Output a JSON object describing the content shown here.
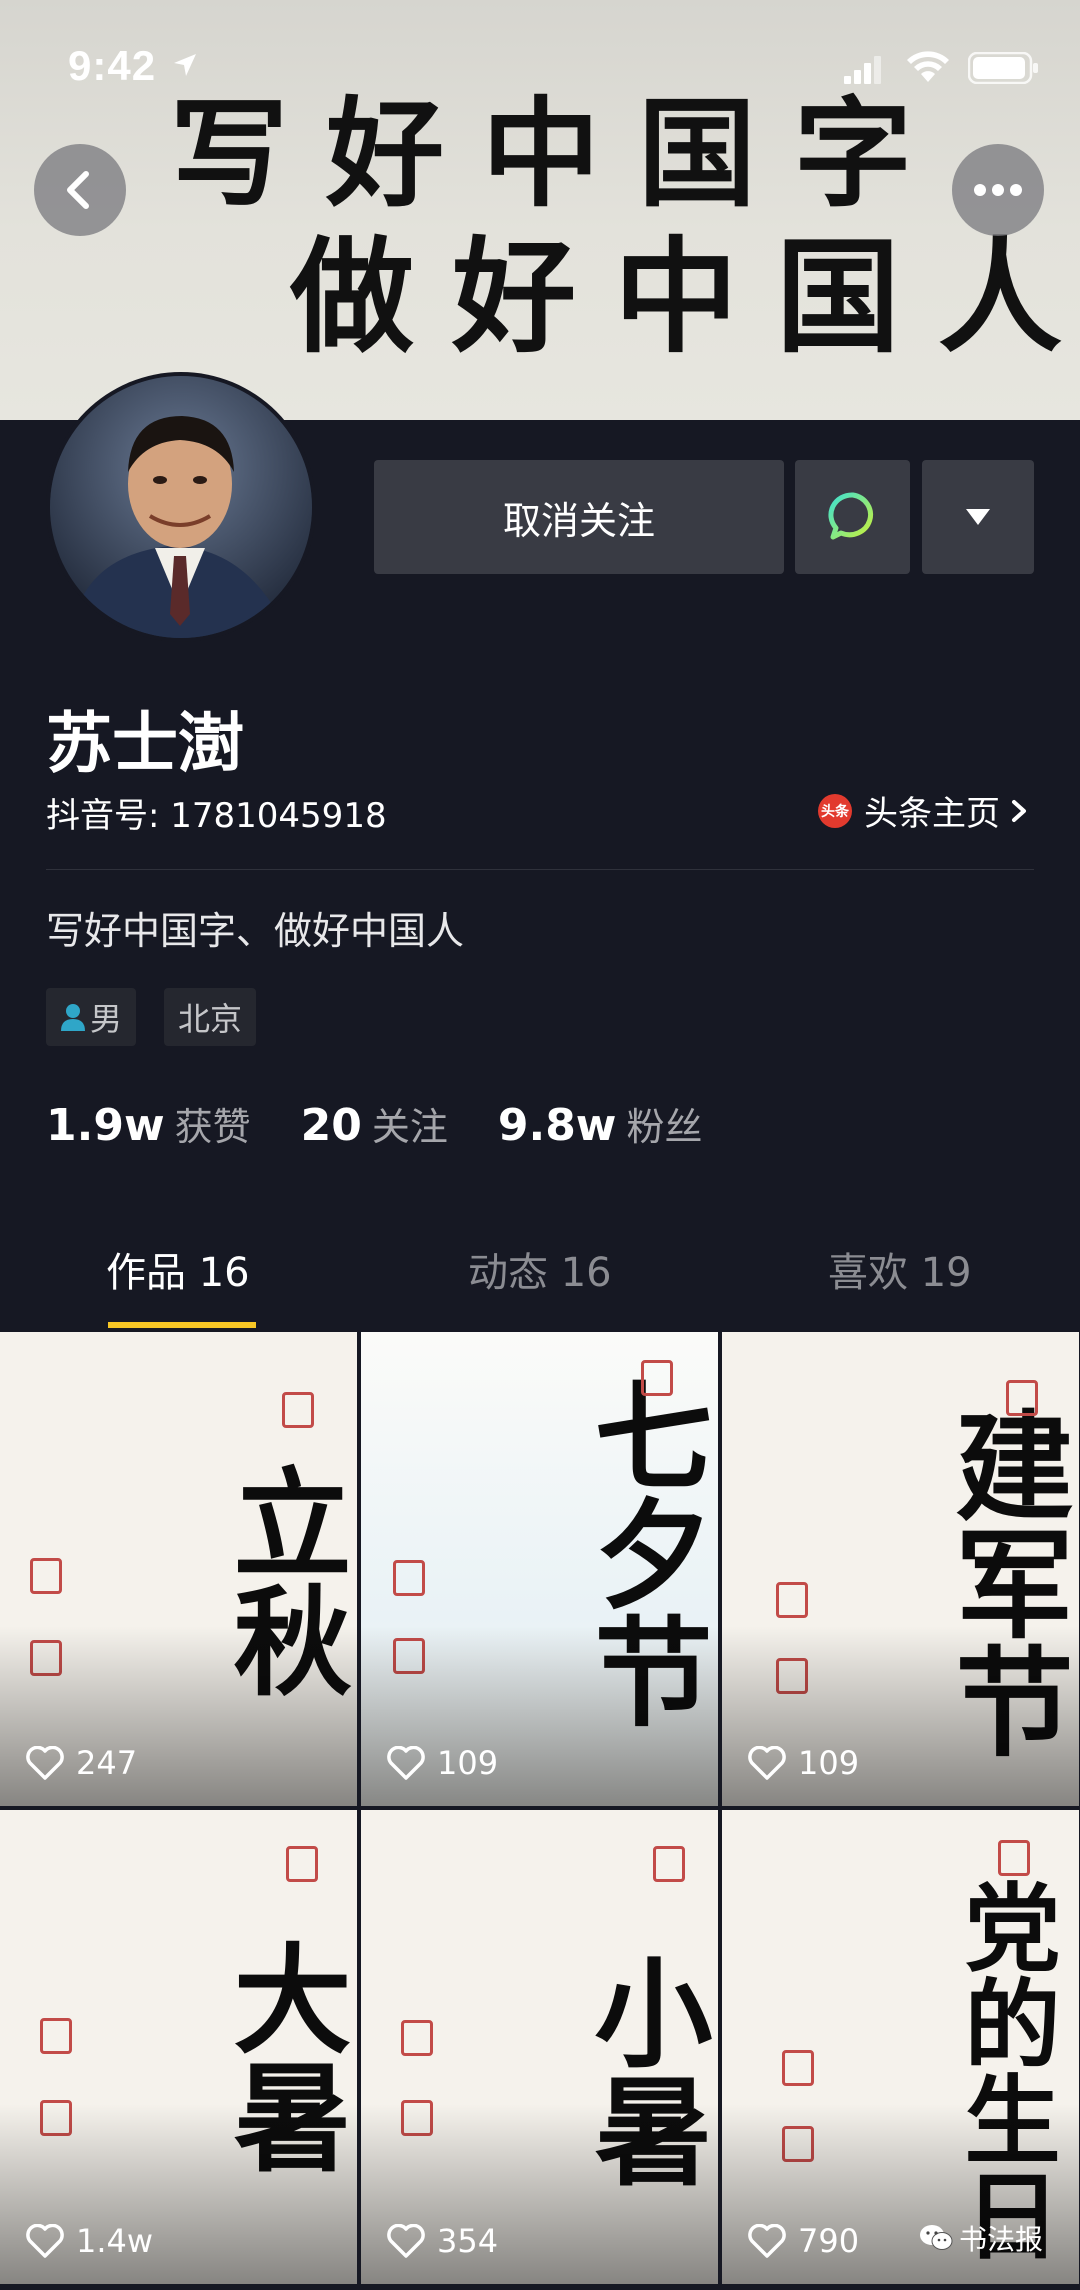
{
  "status_bar": {
    "time": "9:42"
  },
  "banner": {
    "line1": "写好中国字",
    "line2": "做好中国人"
  },
  "profile": {
    "unfollow_label": "取消关注",
    "name": "苏士澍",
    "douyin_id": "抖音号: 1781045918",
    "toutiao_badge": "头条",
    "toutiao_link": "头条主页",
    "bio": "写好中国字、做好中国人",
    "tags": {
      "gender": "男",
      "city": "北京"
    },
    "stats": [
      {
        "num": "1.9w",
        "label": "获赞"
      },
      {
        "num": "20",
        "label": "关注"
      },
      {
        "num": "9.8w",
        "label": "粉丝"
      }
    ]
  },
  "tabs": [
    {
      "label": "作品 16",
      "active": true
    },
    {
      "label": "动态 16",
      "active": false
    },
    {
      "label": "喜欢 19",
      "active": false
    }
  ],
  "videos": [
    {
      "text": "立秋",
      "likes": "247"
    },
    {
      "text": "七夕节",
      "likes": "109"
    },
    {
      "text": "建军节",
      "likes": "109"
    },
    {
      "text": "大暑",
      "likes": "1.4w"
    },
    {
      "text": "小暑",
      "likes": "354"
    },
    {
      "text": "党的生日",
      "likes": "790"
    }
  ],
  "watermark": "书法报",
  "colors": {
    "background": "#161823",
    "accent": "#f7c625",
    "button": "#393b44"
  }
}
